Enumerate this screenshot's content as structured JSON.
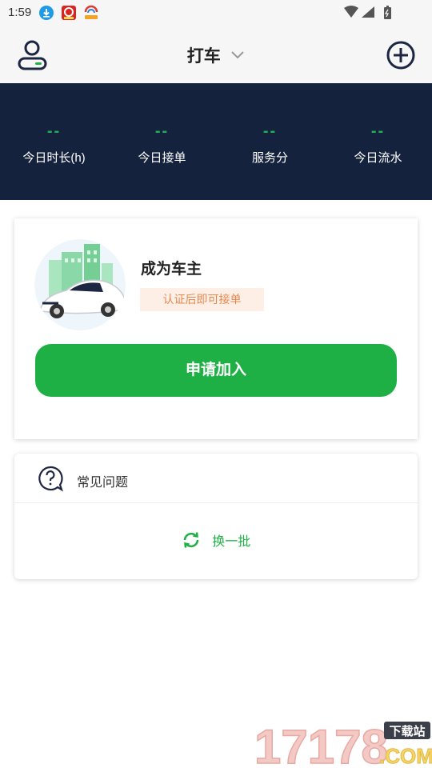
{
  "status_bar": {
    "time": "1:59"
  },
  "header": {
    "title": "打车"
  },
  "stats": [
    {
      "value": "--",
      "label": "今日时长(h)"
    },
    {
      "value": "--",
      "label": "今日接单"
    },
    {
      "value": "--",
      "label": "服务分"
    },
    {
      "value": "--",
      "label": "今日流水"
    }
  ],
  "driver_card": {
    "title": "成为车主",
    "badge": "认证后即可接单",
    "button_label": "申请加入"
  },
  "faq": {
    "title": "常见问题",
    "refresh_label": "换一批"
  },
  "watermark": {
    "text": "17178",
    "sub": "下载站",
    "domain": ".COM"
  },
  "colors": {
    "accent_green": "#1fb045",
    "stats_bg": "#15223d",
    "badge_bg": "#fdeee6",
    "badge_text": "#e58a4f"
  }
}
